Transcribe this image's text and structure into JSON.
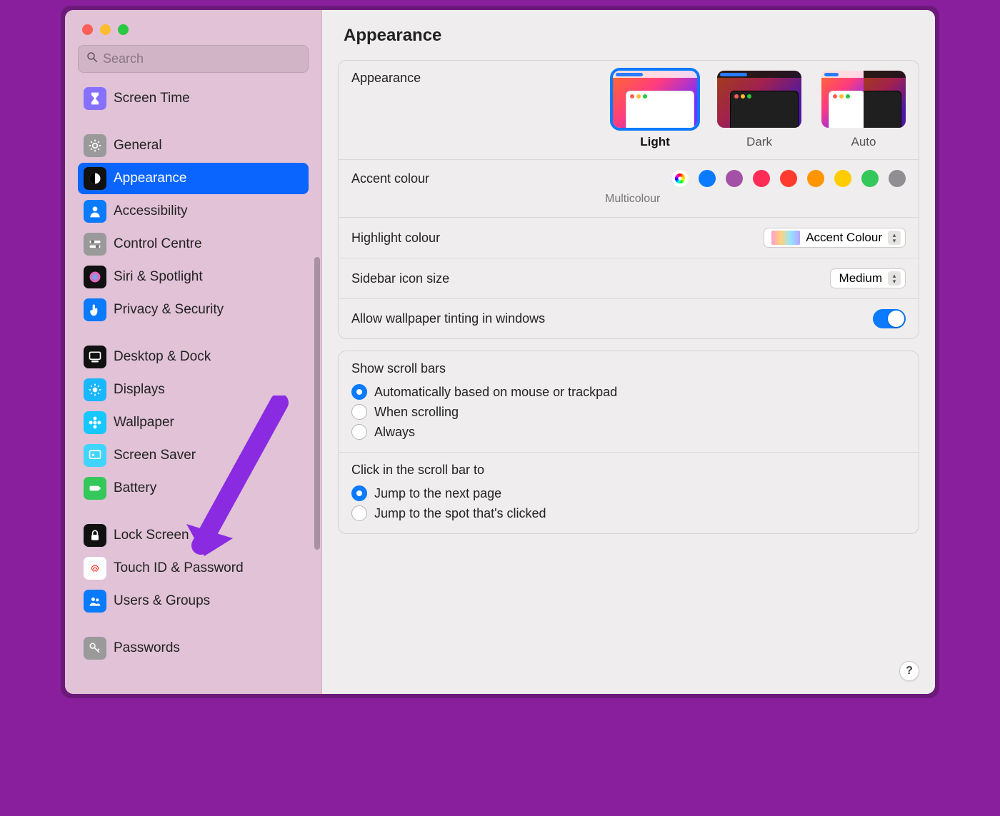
{
  "header": {
    "title": "Appearance"
  },
  "search": {
    "placeholder": "Search"
  },
  "sidebar": {
    "items": [
      {
        "id": "screen-time",
        "label": "Screen Time",
        "iconBg": "#8670ff",
        "icon": "hourglass"
      },
      {
        "gap": true
      },
      {
        "id": "general",
        "label": "General",
        "iconBg": "#9a9a9a",
        "icon": "gear"
      },
      {
        "id": "appearance",
        "label": "Appearance",
        "iconBg": "#111",
        "icon": "contrast",
        "selected": true
      },
      {
        "id": "accessibility",
        "label": "Accessibility",
        "iconBg": "#0a7aff",
        "icon": "person"
      },
      {
        "id": "control-centre",
        "label": "Control Centre",
        "iconBg": "#9a9a9a",
        "icon": "switches"
      },
      {
        "id": "siri",
        "label": "Siri & Spotlight",
        "iconBg": "#111",
        "icon": "siri"
      },
      {
        "id": "privacy",
        "label": "Privacy & Security",
        "iconBg": "#0a7aff",
        "icon": "hand"
      },
      {
        "gap": true
      },
      {
        "id": "desktop",
        "label": "Desktop & Dock",
        "iconBg": "#111",
        "icon": "dock"
      },
      {
        "id": "displays",
        "label": "Displays",
        "iconBg": "#18b7ff",
        "icon": "sun"
      },
      {
        "id": "wallpaper",
        "label": "Wallpaper",
        "iconBg": "#17c7ff",
        "icon": "flower"
      },
      {
        "id": "screensaver",
        "label": "Screen Saver",
        "iconBg": "#3fd5ff",
        "icon": "screensaver"
      },
      {
        "id": "battery",
        "label": "Battery",
        "iconBg": "#34c759",
        "icon": "battery"
      },
      {
        "gap": true
      },
      {
        "id": "lock-screen",
        "label": "Lock Screen",
        "iconBg": "#111",
        "icon": "lock"
      },
      {
        "id": "touchid",
        "label": "Touch ID & Password",
        "iconBg": "#fff",
        "icon": "fingerprint"
      },
      {
        "id": "users",
        "label": "Users & Groups",
        "iconBg": "#0a7aff",
        "icon": "users"
      },
      {
        "gap": true
      },
      {
        "id": "passwords",
        "label": "Passwords",
        "iconBg": "#9a9a9a",
        "icon": "key"
      }
    ]
  },
  "appearance": {
    "label": "Appearance",
    "options": [
      {
        "id": "light",
        "label": "Light",
        "selected": true
      },
      {
        "id": "dark",
        "label": "Dark"
      },
      {
        "id": "auto",
        "label": "Auto"
      }
    ]
  },
  "accent": {
    "label": "Accent colour",
    "caption": "Multicolour",
    "colors": [
      "multicolour",
      "#0a7aff",
      "#a550a7",
      "#ff2d55",
      "#ff3b30",
      "#ff9500",
      "#ffcc00",
      "#34c759",
      "#8e8e93"
    ]
  },
  "highlight": {
    "label": "Highlight colour",
    "value": "Accent Colour"
  },
  "sidebarIcon": {
    "label": "Sidebar icon size",
    "value": "Medium"
  },
  "tinting": {
    "label": "Allow wallpaper tinting in windows",
    "value": true
  },
  "scrollbars": {
    "label": "Show scroll bars",
    "options": [
      {
        "id": "auto",
        "label": "Automatically based on mouse or trackpad",
        "checked": true
      },
      {
        "id": "scrolling",
        "label": "When scrolling"
      },
      {
        "id": "always",
        "label": "Always"
      }
    ]
  },
  "clickScroll": {
    "label": "Click in the scroll bar to",
    "options": [
      {
        "id": "next",
        "label": "Jump to the next page",
        "checked": true
      },
      {
        "id": "spot",
        "label": "Jump to the spot that's clicked"
      }
    ]
  },
  "help": {
    "label": "?"
  }
}
